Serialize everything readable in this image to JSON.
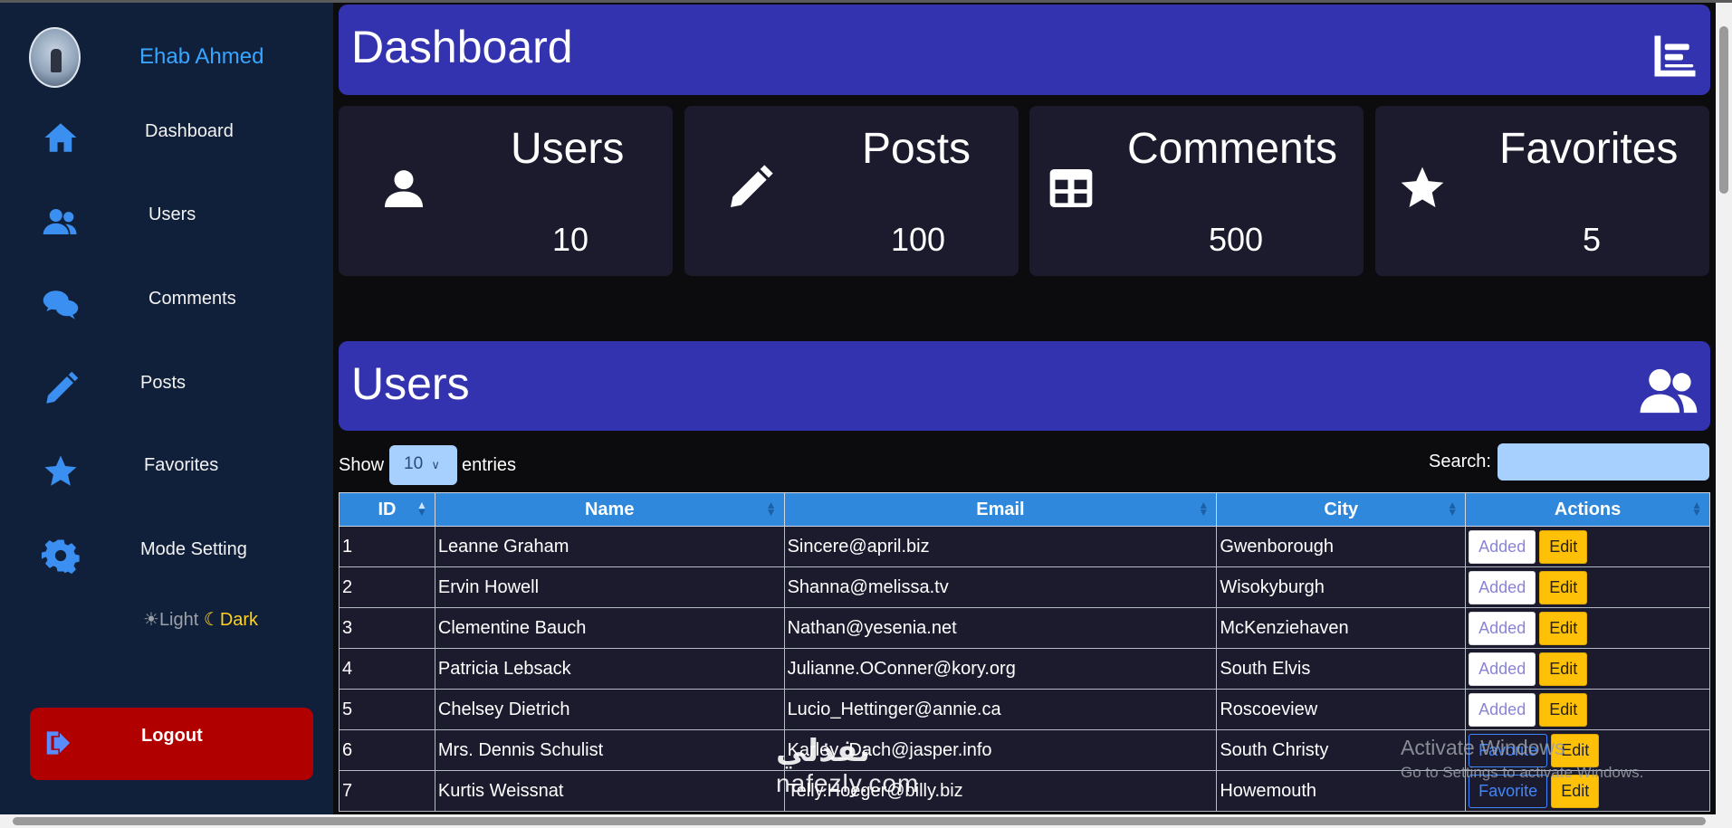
{
  "sidebar": {
    "user_name": "Ehab Ahmed",
    "items": [
      {
        "label": "Dashboard",
        "icon": "home-icon"
      },
      {
        "label": "Users",
        "icon": "users-icon"
      },
      {
        "label": "Comments",
        "icon": "comments-icon"
      },
      {
        "label": "Posts",
        "icon": "pencil-icon"
      },
      {
        "label": "Favorites",
        "icon": "star-icon"
      },
      {
        "label": "Mode Setting",
        "icon": "gear-icon"
      }
    ],
    "mode": {
      "light": "Light",
      "dark": "Dark"
    },
    "logout": "Logout"
  },
  "header": {
    "title": "Dashboard"
  },
  "cards": [
    {
      "title": "Users",
      "value": "10",
      "icon": "user-icon"
    },
    {
      "title": "Posts",
      "value": "100",
      "icon": "pencil-icon"
    },
    {
      "title": "Comments",
      "value": "500",
      "icon": "table-icon"
    },
    {
      "title": "Favorites",
      "value": "5",
      "icon": "star-icon"
    }
  ],
  "users_section": {
    "title": "Users",
    "show_label": "Show",
    "entries_value": "10",
    "entries_label": "entries",
    "search_label": "Search:",
    "columns": [
      "ID",
      "Name",
      "Email",
      "City",
      "Actions"
    ],
    "rows": [
      {
        "id": "1",
        "name": "Leanne Graham",
        "email": "Sincere@april.biz",
        "city": "Gwenborough",
        "action": "Added"
      },
      {
        "id": "2",
        "name": "Ervin Howell",
        "email": "Shanna@melissa.tv",
        "city": "Wisokyburgh",
        "action": "Added"
      },
      {
        "id": "3",
        "name": "Clementine Bauch",
        "email": "Nathan@yesenia.net",
        "city": "McKenziehaven",
        "action": "Added"
      },
      {
        "id": "4",
        "name": "Patricia Lebsack",
        "email": "Julianne.OConner@kory.org",
        "city": "South Elvis",
        "action": "Added"
      },
      {
        "id": "5",
        "name": "Chelsey Dietrich",
        "email": "Lucio_Hettinger@annie.ca",
        "city": "Roscoeview",
        "action": "Added"
      },
      {
        "id": "6",
        "name": "Mrs. Dennis Schulist",
        "email": "Karley_Dach@jasper.info",
        "city": "South Christy",
        "action": "Favorite"
      },
      {
        "id": "7",
        "name": "Kurtis Weissnat",
        "email": "Telly.Hoeger@billy.biz",
        "city": "Howemouth",
        "action": "Favorite"
      }
    ],
    "edit_label": "Edit"
  },
  "watermark": {
    "line1": "Activate Windows",
    "line2": "Go to Settings to activate Windows."
  },
  "brand": {
    "arabic": "نفذلي",
    "latin": "nafezly.com"
  },
  "colors": {
    "sidebar": "#11203a",
    "accent": "#3333b0",
    "card": "#1c1b2e",
    "logout": "#b00000",
    "edit": "#ffc107",
    "name": "#38a6ff"
  }
}
